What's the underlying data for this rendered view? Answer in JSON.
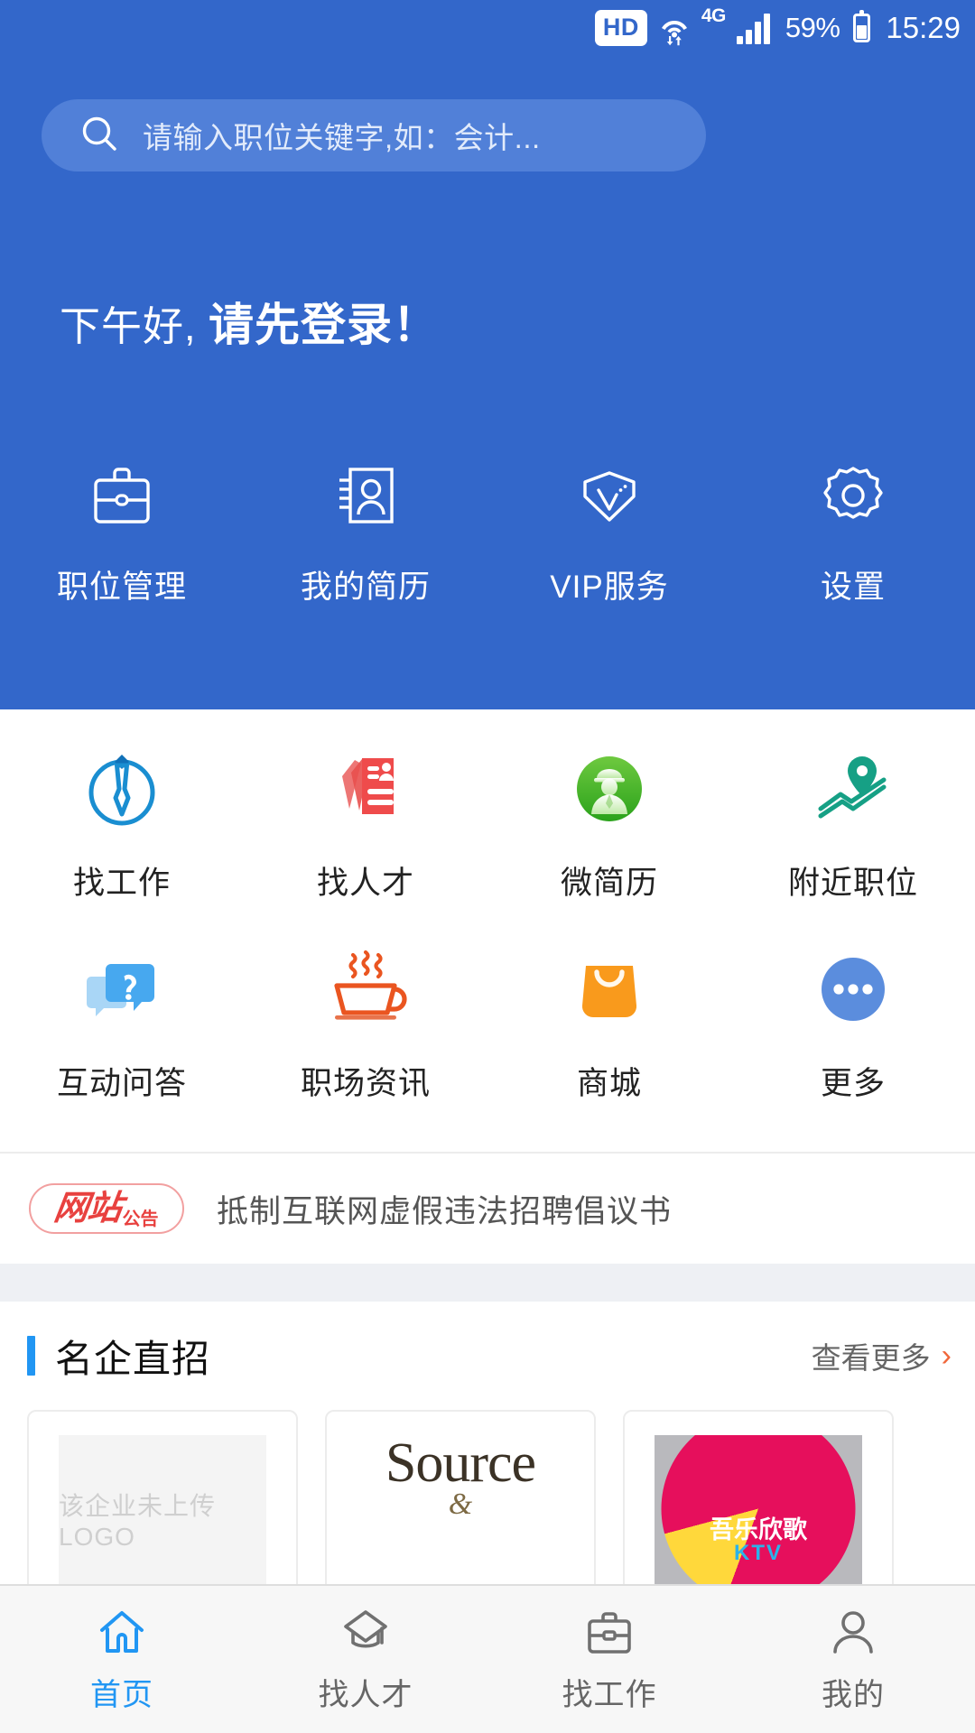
{
  "status_bar": {
    "hd_label": "HD",
    "network_label": "4G",
    "battery_percent": "59%",
    "time": "15:29",
    "icons": [
      "hd-badge",
      "wifi-icon",
      "signal-bars-icon",
      "battery-icon"
    ]
  },
  "search": {
    "placeholder": "请输入职位关键字,如：会计...",
    "icon": "search-icon"
  },
  "greeting": {
    "prefix": "下午好, ",
    "action": "请先登录！"
  },
  "hero_nav": [
    {
      "label": "职位管理",
      "icon": "briefcase-icon"
    },
    {
      "label": "我的简历",
      "icon": "id-card-icon"
    },
    {
      "label": "VIP服务",
      "icon": "diamond-vip-icon"
    },
    {
      "label": "设置",
      "icon": "gear-icon"
    }
  ],
  "grid": {
    "row1": [
      {
        "label": "找工作",
        "icon": "necktie-circle-icon",
        "color": "#1a8ed1"
      },
      {
        "label": "找人才",
        "icon": "resume-cards-icon",
        "color": "#ef4b4b"
      },
      {
        "label": "微简历",
        "icon": "worker-avatar-icon",
        "color": "#4bb72a"
      },
      {
        "label": "附近职位",
        "icon": "map-pin-icon",
        "color": "#16a085"
      }
    ],
    "row2": [
      {
        "label": "互动问答",
        "icon": "chat-question-icon",
        "color": "#47a8ef"
      },
      {
        "label": "职场资讯",
        "icon": "coffee-cup-icon",
        "color": "#ea5520"
      },
      {
        "label": "商城",
        "icon": "shopping-bag-icon",
        "color": "#f99a1c"
      },
      {
        "label": "更多",
        "icon": "ellipsis-circle-icon",
        "color": "#5b8ddd"
      }
    ]
  },
  "announcement": {
    "badge_main": "网站",
    "badge_sub": "公告",
    "text": "抵制互联网虚假违法招聘倡议书"
  },
  "featured_section": {
    "title": "名企直招",
    "more_label": "查看更多",
    "more_icon": "chevron-right-icon",
    "cards": [
      {
        "type": "empty-logo",
        "placeholder": "该企业未上传LOGO"
      },
      {
        "type": "source-logo",
        "line1": "Source",
        "line2": "&"
      },
      {
        "type": "ktv-logo",
        "line1": "吾乐欣歌",
        "line2": "KTV"
      }
    ]
  },
  "tabbar": [
    {
      "label": "首页",
      "icon": "home-icon",
      "active": true
    },
    {
      "label": "找人才",
      "icon": "graduation-cap-icon",
      "active": false
    },
    {
      "label": "找工作",
      "icon": "briefcase-icon",
      "active": false
    },
    {
      "label": "我的",
      "icon": "person-icon",
      "active": false
    }
  ],
  "colors": {
    "hero_blue": "#3367ca",
    "search_blue": "#5180d8",
    "accent_blue": "#2196f3",
    "announce_red": "#e8413f",
    "chevron_orange": "#f0663a"
  }
}
